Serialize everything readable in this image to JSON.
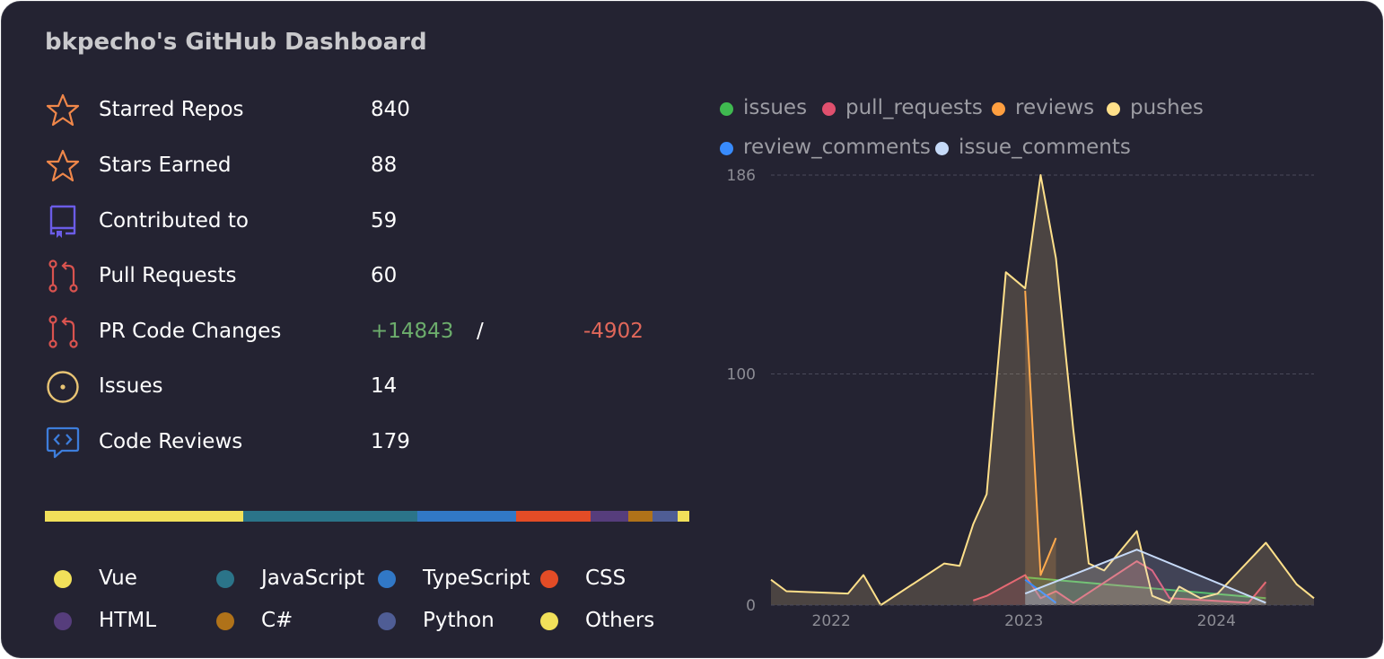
{
  "title": "bkpecho's GitHub Dashboard",
  "stats": [
    {
      "label": "Starred Repos",
      "value": "840",
      "icon": "star-icon"
    },
    {
      "label": "Stars Earned",
      "value": "88",
      "icon": "star-icon"
    },
    {
      "label": "Contributed to",
      "value": "59",
      "icon": "repo-icon"
    },
    {
      "label": "Pull Requests",
      "value": "60",
      "icon": "pull-request-icon"
    },
    {
      "label": "PR Code Changes",
      "additions": "+14843",
      "separator": "/",
      "deletions": "-4902",
      "icon": "pull-request-icon"
    },
    {
      "label": "Issues",
      "value": "14",
      "icon": "issue-icon"
    },
    {
      "label": "Code Reviews",
      "value": "179",
      "icon": "code-review-icon"
    }
  ],
  "languages": [
    {
      "name": "Vue",
      "color": "#f1e05a",
      "share": 30.8
    },
    {
      "name": "JavaScript",
      "color": "#2b7489",
      "share": 27.0
    },
    {
      "name": "TypeScript",
      "color": "#3178c6",
      "share": 15.3
    },
    {
      "name": "CSS",
      "color": "#e34c26",
      "share": 11.6
    },
    {
      "name": "HTML",
      "color": "#563d7c",
      "share": 5.8
    },
    {
      "name": "C#",
      "color": "#b07219",
      "share": 3.8
    },
    {
      "name": "Python",
      "color": "#4f5d95",
      "share": 3.9
    },
    {
      "name": "Others",
      "color": "#f1e05a",
      "share": 1.8
    }
  ],
  "chart_data": {
    "type": "area",
    "ylim": [
      0,
      186
    ],
    "y_ticks": [
      0,
      100,
      186
    ],
    "x_ticks": [
      "2022",
      "2023",
      "2024"
    ],
    "xlim": [
      2021.85,
      2024.67
    ],
    "grid": true,
    "legend_position": "top",
    "series": [
      {
        "name": "issues",
        "color": "#3fb950",
        "points": [
          [
            2023.17,
            12
          ],
          [
            2024.42,
            3
          ]
        ]
      },
      {
        "name": "pull_requests",
        "color": "#e0506e",
        "points": [
          [
            2022.9,
            2
          ],
          [
            2022.97,
            4
          ],
          [
            2023.17,
            13
          ],
          [
            2023.25,
            3
          ],
          [
            2023.33,
            6
          ],
          [
            2023.42,
            1
          ],
          [
            2023.75,
            19
          ],
          [
            2023.83,
            15
          ],
          [
            2023.92,
            3
          ],
          [
            2024.33,
            1
          ],
          [
            2024.42,
            10
          ]
        ]
      },
      {
        "name": "reviews",
        "color": "#ff9f40",
        "points": [
          [
            2023.17,
            136
          ],
          [
            2023.25,
            13
          ],
          [
            2023.33,
            29
          ]
        ]
      },
      {
        "name": "pushes",
        "color": "#ffe08a",
        "points": [
          [
            2021.85,
            11
          ],
          [
            2021.93,
            6
          ],
          [
            2022.25,
            5
          ],
          [
            2022.33,
            13
          ],
          [
            2022.42,
            0
          ],
          [
            2022.75,
            18
          ],
          [
            2022.83,
            17
          ],
          [
            2022.9,
            35
          ],
          [
            2022.97,
            48
          ],
          [
            2023.07,
            144
          ],
          [
            2023.17,
            137
          ],
          [
            2023.25,
            186
          ],
          [
            2023.33,
            150
          ],
          [
            2023.42,
            76
          ],
          [
            2023.5,
            18
          ],
          [
            2023.58,
            15
          ],
          [
            2023.75,
            32
          ],
          [
            2023.83,
            4
          ],
          [
            2023.92,
            1
          ],
          [
            2023.97,
            8
          ],
          [
            2024.08,
            3
          ],
          [
            2024.17,
            5
          ],
          [
            2024.42,
            27
          ],
          [
            2024.58,
            9
          ],
          [
            2024.67,
            3
          ]
        ]
      },
      {
        "name": "review_comments",
        "color": "#388bfd",
        "points": [
          [
            2023.17,
            11
          ],
          [
            2023.33,
            1
          ]
        ]
      },
      {
        "name": "issue_comments",
        "color": "#c6daf8",
        "points": [
          [
            2023.17,
            5
          ],
          [
            2023.75,
            24
          ],
          [
            2024.42,
            1
          ]
        ]
      }
    ]
  }
}
